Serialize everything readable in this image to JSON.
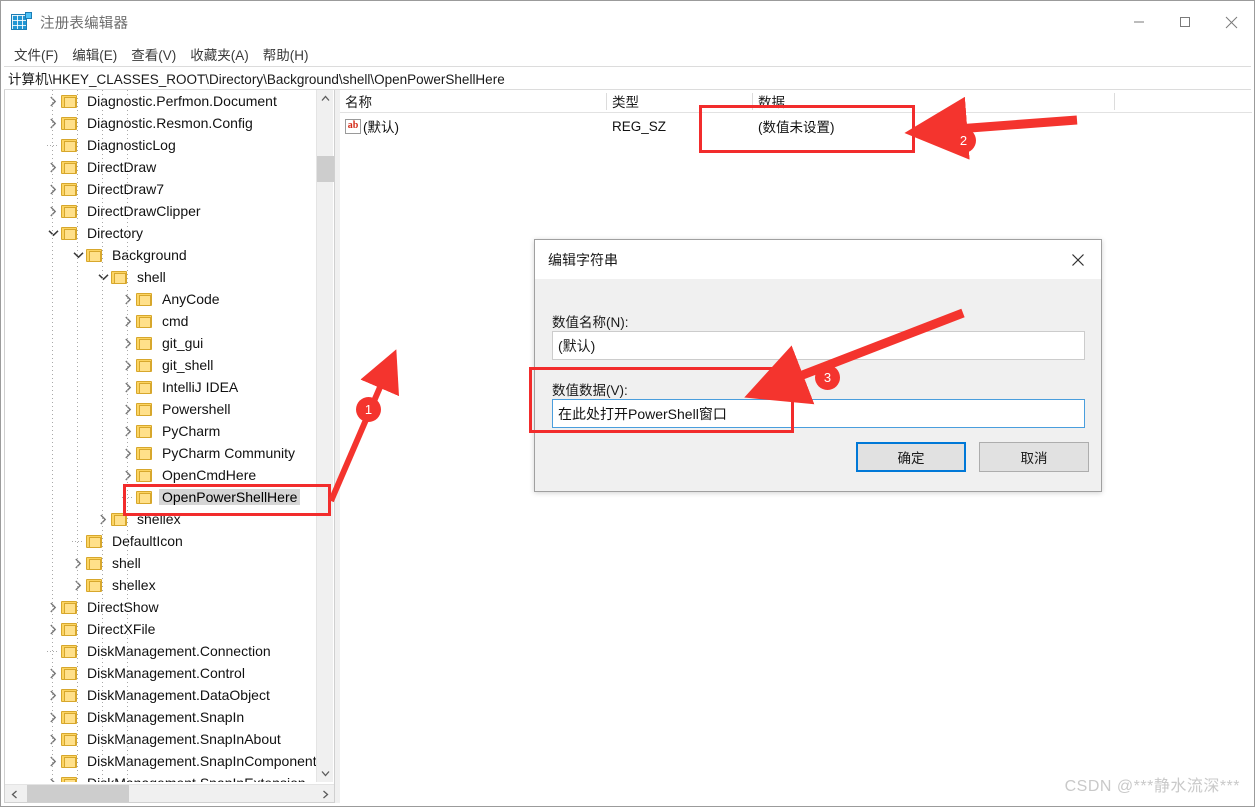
{
  "window": {
    "title": "注册表编辑器",
    "icon": "registry-editor-icon",
    "minimize_label": "—",
    "maximize_label": "□",
    "close_label": "✕"
  },
  "menubar": {
    "items": [
      {
        "label": "文件(F)",
        "name": "menu-file"
      },
      {
        "label": "编辑(E)",
        "name": "menu-edit"
      },
      {
        "label": "查看(V)",
        "name": "menu-view"
      },
      {
        "label": "收藏夹(A)",
        "name": "menu-favorites"
      },
      {
        "label": "帮助(H)",
        "name": "menu-help"
      }
    ]
  },
  "address": {
    "path": "计算机\\HKEY_CLASSES_ROOT\\Directory\\Background\\shell\\OpenPowerShellHere"
  },
  "tree": {
    "items": [
      {
        "label": "Diagnostic.Perfmon.Document",
        "depth": 1,
        "twisty": "collapsed",
        "selected": false
      },
      {
        "label": "Diagnostic.Resmon.Config",
        "depth": 1,
        "twisty": "collapsed",
        "selected": false
      },
      {
        "label": "DiagnosticLog",
        "depth": 1,
        "twisty": "none",
        "selected": false
      },
      {
        "label": "DirectDraw",
        "depth": 1,
        "twisty": "collapsed",
        "selected": false
      },
      {
        "label": "DirectDraw7",
        "depth": 1,
        "twisty": "collapsed",
        "selected": false
      },
      {
        "label": "DirectDrawClipper",
        "depth": 1,
        "twisty": "collapsed",
        "selected": false
      },
      {
        "label": "Directory",
        "depth": 1,
        "twisty": "expanded",
        "selected": false
      },
      {
        "label": "Background",
        "depth": 2,
        "twisty": "expanded",
        "selected": false
      },
      {
        "label": "shell",
        "depth": 3,
        "twisty": "expanded",
        "selected": false
      },
      {
        "label": "AnyCode",
        "depth": 4,
        "twisty": "collapsed",
        "selected": false
      },
      {
        "label": "cmd",
        "depth": 4,
        "twisty": "collapsed",
        "selected": false
      },
      {
        "label": "git_gui",
        "depth": 4,
        "twisty": "collapsed",
        "selected": false
      },
      {
        "label": "git_shell",
        "depth": 4,
        "twisty": "collapsed",
        "selected": false
      },
      {
        "label": "IntelliJ IDEA",
        "depth": 4,
        "twisty": "collapsed",
        "selected": false
      },
      {
        "label": "Powershell",
        "depth": 4,
        "twisty": "collapsed",
        "selected": false
      },
      {
        "label": "PyCharm",
        "depth": 4,
        "twisty": "collapsed",
        "selected": false
      },
      {
        "label": "PyCharm Community",
        "depth": 4,
        "twisty": "collapsed",
        "selected": false
      },
      {
        "label": "OpenCmdHere",
        "depth": 4,
        "twisty": "collapsed",
        "selected": false
      },
      {
        "label": "OpenPowerShellHere",
        "depth": 4,
        "twisty": "none",
        "selected": true
      },
      {
        "label": "shellex",
        "depth": 3,
        "twisty": "collapsed",
        "selected": false
      },
      {
        "label": "DefaultIcon",
        "depth": 2,
        "twisty": "none",
        "selected": false
      },
      {
        "label": "shell",
        "depth": 2,
        "twisty": "collapsed",
        "selected": false
      },
      {
        "label": "shellex",
        "depth": 2,
        "twisty": "collapsed",
        "selected": false
      },
      {
        "label": "DirectShow",
        "depth": 1,
        "twisty": "collapsed",
        "selected": false
      },
      {
        "label": "DirectXFile",
        "depth": 1,
        "twisty": "collapsed",
        "selected": false
      },
      {
        "label": "DiskManagement.Connection",
        "depth": 1,
        "twisty": "none",
        "selected": false
      },
      {
        "label": "DiskManagement.Control",
        "depth": 1,
        "twisty": "collapsed",
        "selected": false
      },
      {
        "label": "DiskManagement.DataObject",
        "depth": 1,
        "twisty": "collapsed",
        "selected": false
      },
      {
        "label": "DiskManagement.SnapIn",
        "depth": 1,
        "twisty": "collapsed",
        "selected": false
      },
      {
        "label": "DiskManagement.SnapInAbout",
        "depth": 1,
        "twisty": "collapsed",
        "selected": false
      },
      {
        "label": "DiskManagement.SnapInComponent",
        "depth": 1,
        "twisty": "collapsed",
        "selected": false
      },
      {
        "label": "DiskManagement.SnapInExtension",
        "depth": 1,
        "twisty": "collapsed",
        "selected": false
      }
    ]
  },
  "values_list": {
    "columns": [
      {
        "label": "名称",
        "name": "column-name"
      },
      {
        "label": "类型",
        "name": "column-type"
      },
      {
        "label": "数据",
        "name": "column-data"
      }
    ],
    "rows": [
      {
        "name": "(默认)",
        "type": "REG_SZ",
        "data": "(数值未设置)",
        "icon": "string-value-icon"
      }
    ]
  },
  "dialog": {
    "title": "编辑字符串",
    "close_label": "✕",
    "name_label": "数值名称(N):",
    "name_value": "(默认)",
    "data_label": "数值数据(V):",
    "data_value": "在此处打开PowerShell窗口",
    "ok_label": "确定",
    "cancel_label": "取消"
  },
  "annotations": {
    "accent_color": "#f4342e",
    "markers": [
      {
        "id": "1",
        "label": "1"
      },
      {
        "id": "2",
        "label": "2"
      },
      {
        "id": "3",
        "label": "3"
      }
    ]
  },
  "watermark": {
    "text": "CSDN @***静水流深***"
  }
}
